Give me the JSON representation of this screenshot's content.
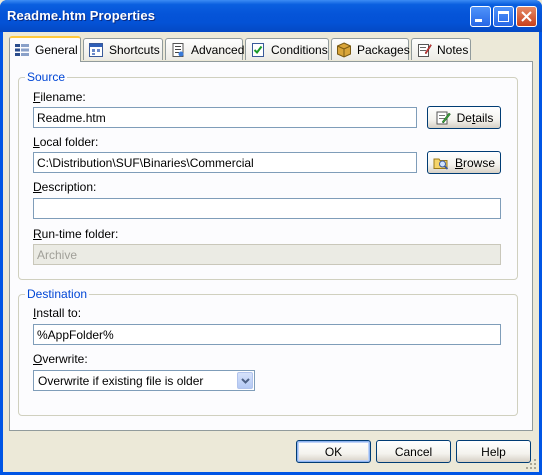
{
  "window": {
    "title": "Readme.htm Properties"
  },
  "tabs": [
    {
      "label": "General",
      "icon": "general-tab-icon"
    },
    {
      "label": "Shortcuts",
      "icon": "shortcuts-tab-icon"
    },
    {
      "label": "Advanced",
      "icon": "advanced-tab-icon"
    },
    {
      "label": "Conditions",
      "icon": "conditions-tab-icon"
    },
    {
      "label": "Packages",
      "icon": "packages-tab-icon"
    },
    {
      "label": "Notes",
      "icon": "notes-tab-icon"
    }
  ],
  "source": {
    "legend": "Source",
    "filename_label_key": "F",
    "filename_label_rest": "ilename:",
    "filename_value": "Readme.htm",
    "details_label_pre": "De",
    "details_label_key": "t",
    "details_label_post": "ails",
    "local_folder_label_key": "L",
    "local_folder_label_rest": "ocal folder:",
    "local_folder_value": "C:\\Distribution\\SUF\\Binaries\\Commercial",
    "browse_label_key": "B",
    "browse_label_rest": "rowse",
    "description_label_key": "D",
    "description_label_rest": "escription:",
    "description_value": "",
    "runtime_label_key": "R",
    "runtime_label_rest": "un-time folder:",
    "runtime_value": "Archive"
  },
  "destination": {
    "legend": "Destination",
    "install_label_key": "I",
    "install_label_rest": "nstall to:",
    "install_value": "%AppFolder%",
    "overwrite_label_key": "O",
    "overwrite_label_rest": "verwrite:",
    "overwrite_selected": "Overwrite if existing file is older"
  },
  "buttons": {
    "ok": "OK",
    "cancel": "Cancel",
    "help": "Help"
  }
}
